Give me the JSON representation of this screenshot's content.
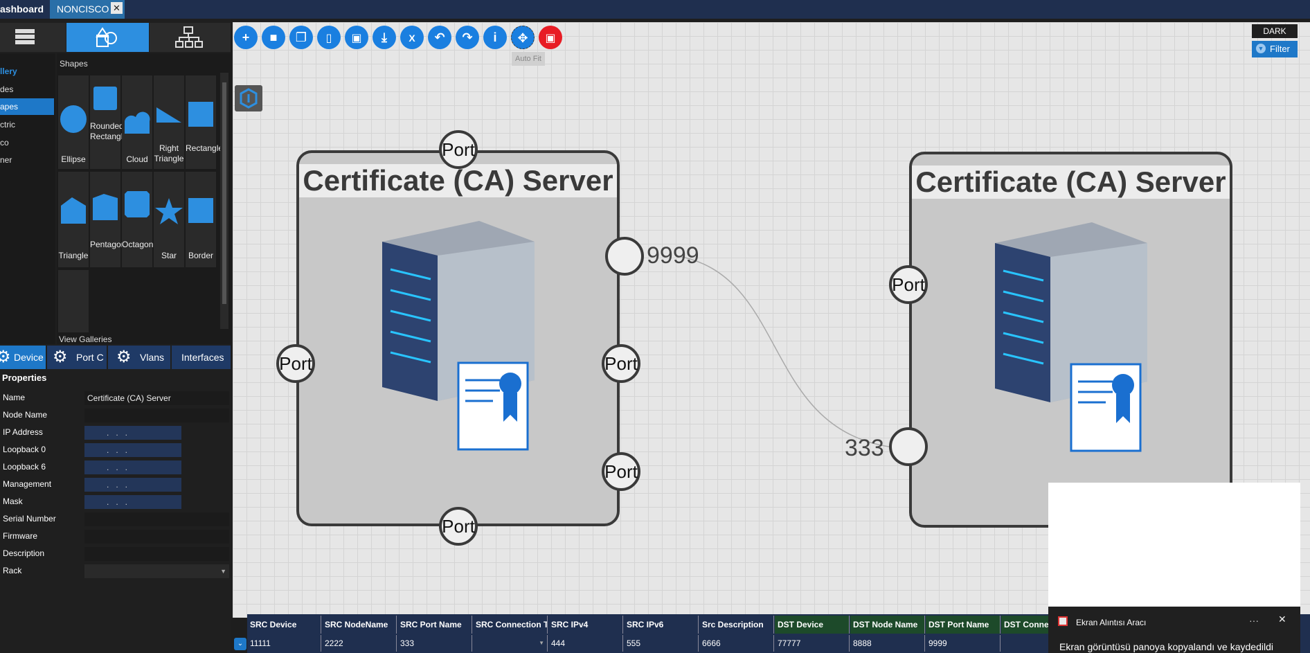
{
  "tabs": [
    {
      "label": "ashboard"
    },
    {
      "label": "NONCISCO"
    }
  ],
  "toolbar": {
    "tooltip": "Auto Fit",
    "dark_label": "DARK",
    "filter_label": "Filter"
  },
  "gallery": {
    "header": "llery",
    "items": [
      "des",
      "apes",
      "ctric",
      "co",
      "ner"
    ],
    "shapes_title": "Shapes",
    "view_galleries": "View Galleries",
    "shapes": [
      "Ellipse",
      "Rounded Rectangle",
      "Cloud",
      "Right Triangle",
      "Rectangle",
      "Triangle",
      "Pentagon",
      "Octagon",
      "Star",
      "Border"
    ]
  },
  "prop_tabs": [
    "Device",
    "Port C",
    "Vlans",
    "Interfaces"
  ],
  "properties": {
    "title": "Properties",
    "rows": [
      {
        "label": "Name",
        "value": "Certificate (CA) Server"
      },
      {
        "label": "Node Name",
        "value": ""
      },
      {
        "label": "IP Address",
        "value": ".   .   ."
      },
      {
        "label": "Loopback 0",
        "value": ".   .   ."
      },
      {
        "label": "Loopback 6",
        "value": ".   .   ."
      },
      {
        "label": "Management",
        "value": ".   .   ."
      },
      {
        "label": "Mask",
        "value": ".   .   ."
      },
      {
        "label": "Serial Number",
        "value": ""
      },
      {
        "label": "Firmware",
        "value": ""
      },
      {
        "label": "Description",
        "value": ""
      },
      {
        "label": "Rack",
        "value": ""
      }
    ]
  },
  "devices": [
    {
      "title": "Certificate (CA) Server",
      "ports": [
        "Port",
        "Port",
        "Port",
        "Port",
        "Port"
      ]
    },
    {
      "title": "Certificate (CA) Server",
      "ports": [
        "Port"
      ]
    }
  ],
  "connection": {
    "src_port": "9999",
    "dst_port": "333"
  },
  "table": {
    "headers": [
      "SRC Device",
      "SRC NodeName",
      "SRC Port Name",
      "SRC Connection Typ",
      "SRC IPv4",
      "SRC IPv6",
      "Src Description",
      "DST Device",
      "DST Node Name",
      "DST Port Name",
      "DST Connection"
    ],
    "row": [
      "11111",
      "2222",
      "333",
      "",
      "444",
      "555",
      "6666",
      "77777",
      "8888",
      "9999",
      ""
    ]
  },
  "toast": {
    "app": "Ekran Alıntısı Aracı",
    "message": "Ekran görüntüsü panoya kopyalandı ve kaydedildi"
  }
}
